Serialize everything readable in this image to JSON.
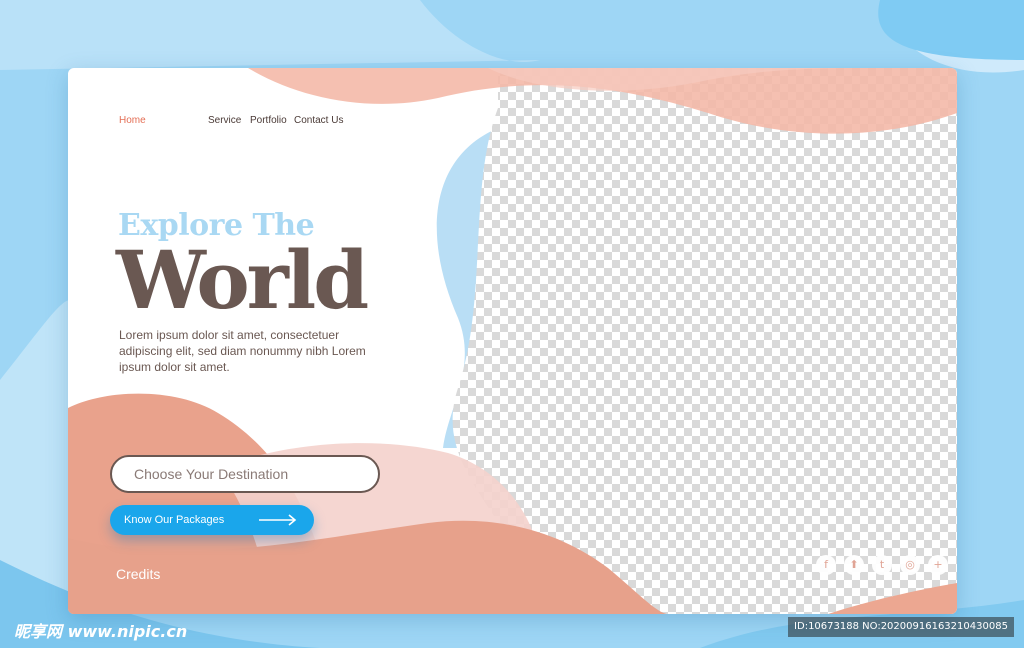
{
  "nav": {
    "items": [
      {
        "label": "Home",
        "active": true
      },
      {
        "label": "Service",
        "active": false
      },
      {
        "label": "Portfolio",
        "active": false
      },
      {
        "label": "Contact Us",
        "active": false
      }
    ]
  },
  "hero": {
    "kicker": "Explore The",
    "title": "World",
    "body": "Lorem ipsum dolor sit amet, consectetuer adipiscing elit, sed diam nonummy nibh Lorem ipsum dolor sit amet."
  },
  "search": {
    "placeholder": "Choose Your Destination",
    "value": ""
  },
  "cta": {
    "label": "Know Our Packages"
  },
  "footer": {
    "credits": "Credits"
  },
  "social": {
    "icons": [
      "facebook-icon",
      "upload-icon",
      "twitter-icon",
      "instagram-icon",
      "plus-icon"
    ]
  },
  "watermark": {
    "left": "昵享网 www.nipic.cn",
    "right": "ID:10673188 NO:20200916163210430085"
  },
  "colors": {
    "page_bg": "#9ed6f5",
    "peach": "#e8a08a",
    "peach_light": "#f2c7bc",
    "sky": "#a9d8f3",
    "title": "#6a5852",
    "home_active": "#e46f56",
    "cta_blue": "#1aa6eb"
  }
}
